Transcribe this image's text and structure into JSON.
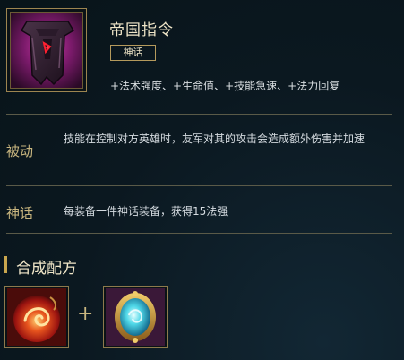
{
  "item": {
    "name": "帝国指令",
    "badge": "神话",
    "stats": "+法术强度、+生命值、+技能急速、+法力回复",
    "icon": "imperial-mandate-icon"
  },
  "passive": {
    "label": "被动",
    "text": "技能在控制对方英雄时，友军对其的攻击会造成额外伤害并加速"
  },
  "mythic": {
    "label": "神话",
    "text": "每装备一件神话装备，获得15法强"
  },
  "recipe": {
    "title": "合成配方",
    "plus": "+",
    "components": [
      {
        "icon": "fiery-orb-icon"
      },
      {
        "icon": "sapphire-crystal-icon"
      }
    ]
  },
  "colors": {
    "background": "#0b1820",
    "gold_accent": "#c9b67f",
    "divider": "#5a5a48",
    "badge_border": "#b59a5c"
  }
}
